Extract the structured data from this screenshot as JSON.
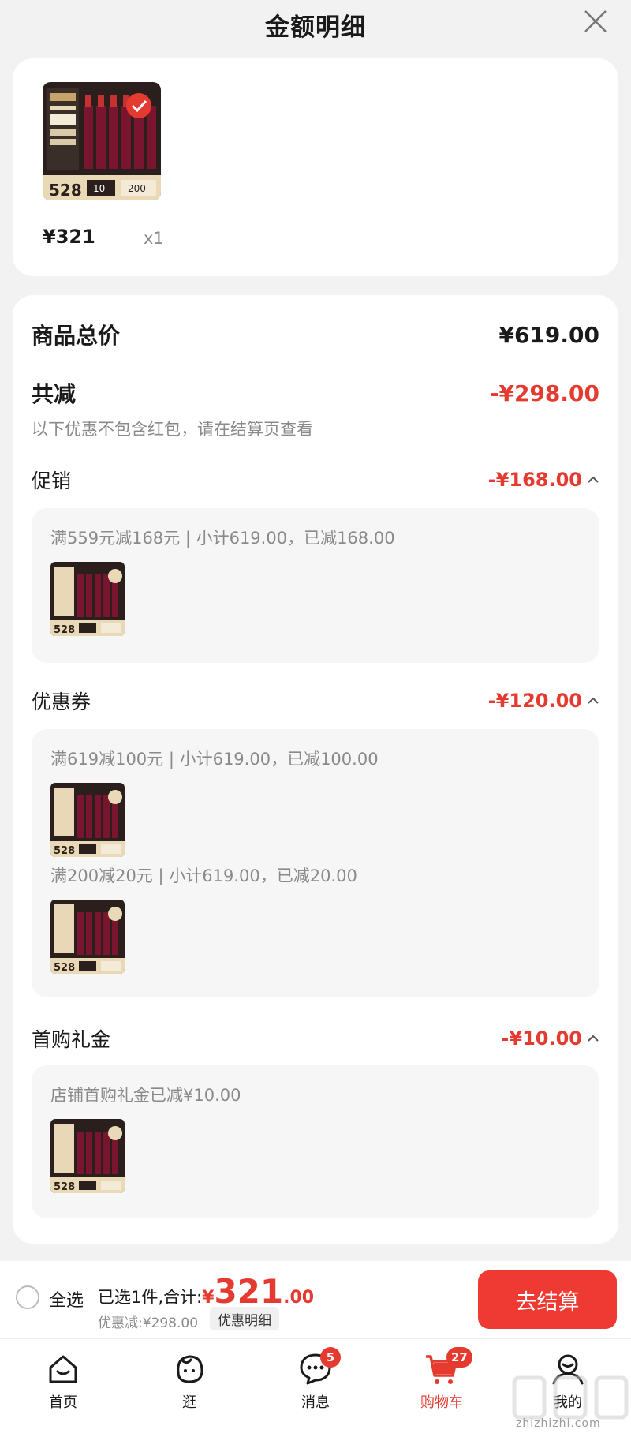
{
  "header": {
    "title": "金额明细"
  },
  "product": {
    "price": "¥321",
    "qty": "x1"
  },
  "summary": {
    "total_label": "商品总价",
    "total_value": "¥619.00",
    "reduce_label": "共减",
    "reduce_value": "-¥298.00",
    "note": "以下优惠不包含红包，请在结算页查看"
  },
  "sections": {
    "promo": {
      "label": "促销",
      "value": "-¥168.00",
      "rules": [
        "满559元减168元 | 小计619.00，已减168.00"
      ]
    },
    "coupon": {
      "label": "优惠券",
      "value": "-¥120.00",
      "rules": [
        "满619减100元 | 小计619.00，已减100.00",
        "满200减20元 | 小计619.00，已减20.00"
      ]
    },
    "gift": {
      "label": "首购礼金",
      "value": "-¥10.00",
      "rules": [
        "店铺首购礼金已减¥10.00"
      ]
    }
  },
  "thumb": {
    "price_tag": "528",
    "tag2": "10",
    "tag3": "200"
  },
  "bottom_bar": {
    "select_all": "全选",
    "selected_text": "已选1件,合计:",
    "currency": "¥",
    "total_int": "321",
    "total_dec": ".00",
    "discount_text": "优惠减:¥298.00",
    "detail_button": "优惠明细",
    "checkout_button": "去结算"
  },
  "tabs": [
    {
      "label": "首页",
      "icon": "home-icon"
    },
    {
      "label": "逛",
      "icon": "face-icon"
    },
    {
      "label": "消息",
      "icon": "chat-icon",
      "badge": "5"
    },
    {
      "label": "购物车",
      "icon": "cart-icon",
      "badge": "27",
      "active": true
    },
    {
      "label": "我的",
      "icon": "user-icon"
    }
  ],
  "watermark": {
    "text": "zhizhizhi.com"
  },
  "colors": {
    "accent": "#e53a2f",
    "checkout": "#ee3a32",
    "background": "#f2f2f2"
  }
}
